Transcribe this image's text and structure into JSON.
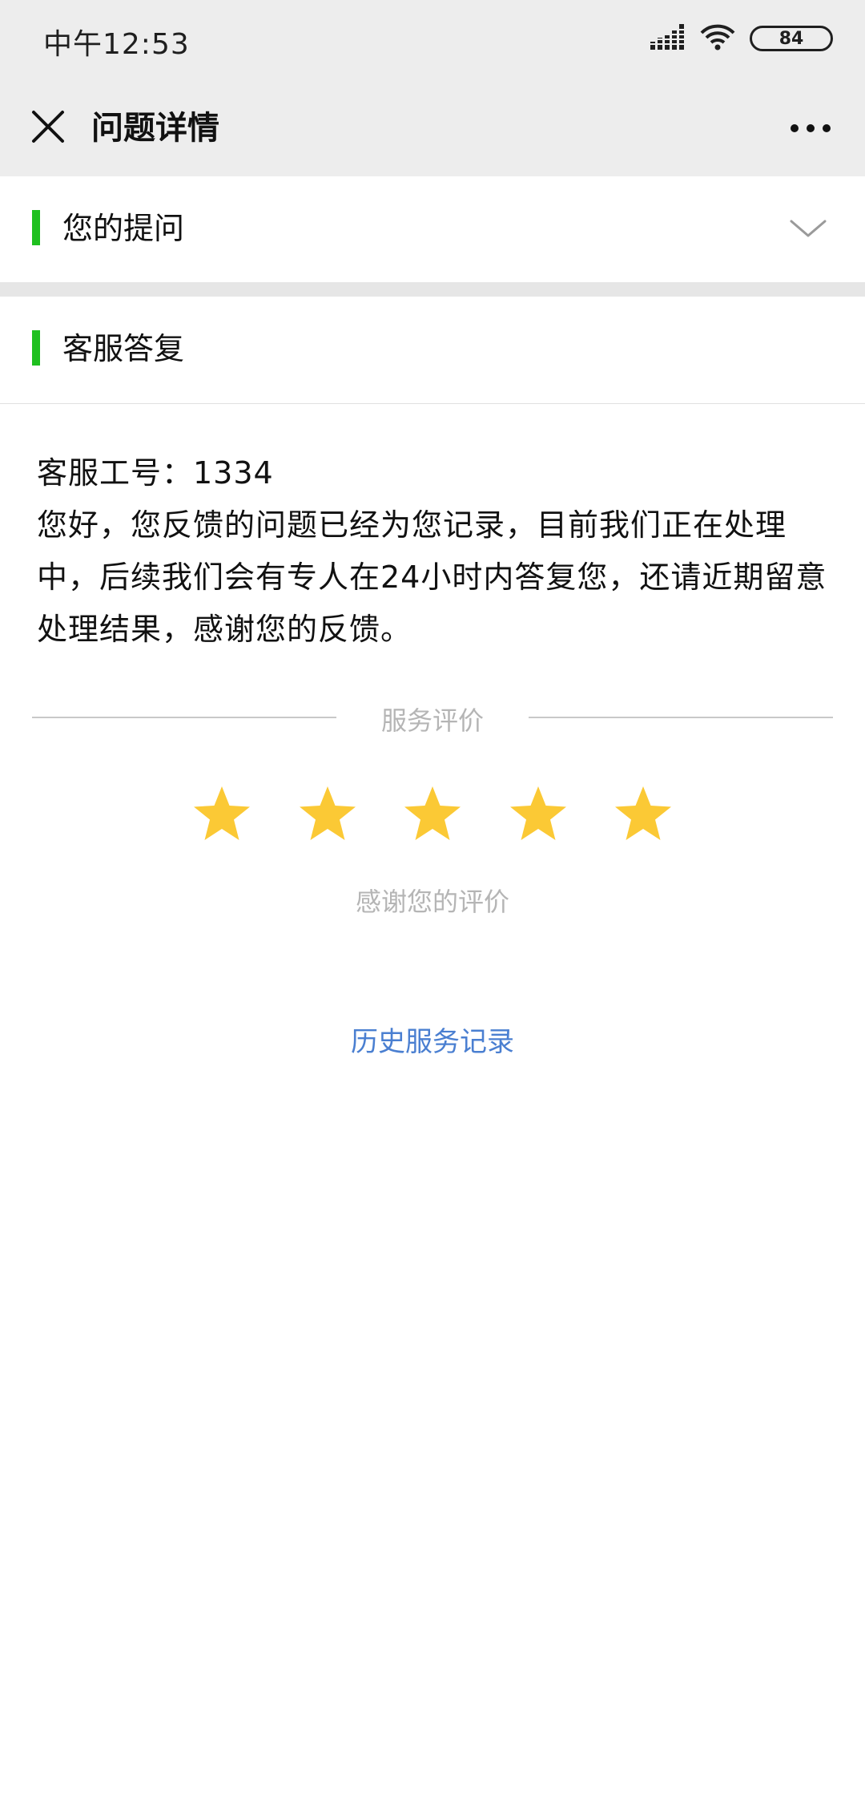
{
  "status_bar": {
    "time": "中午12:53",
    "battery": "84",
    "icons": [
      "signal-icon",
      "wifi-icon",
      "battery-icon"
    ]
  },
  "header": {
    "title": "问题详情",
    "close_icon": "close-icon",
    "more_icon": "more-icon"
  },
  "sections": {
    "question_title": "您的提问",
    "reply_title": "客服答复"
  },
  "reply": {
    "agent_id": "客服工号：1334",
    "message": "您好，您反馈的问题已经为您记录，目前我们正在处理中，后续我们会有专人在24小时内答复您，还请近期留意处理结果，感谢您的反馈。"
  },
  "rating": {
    "label": "服务评价",
    "stars": 5,
    "max_stars": 5,
    "thanks": "感谢您的评价"
  },
  "history_link": "历史服务记录",
  "colors": {
    "accent_green": "#1fc01f",
    "star": "#fbc935",
    "link": "#4a7fd1",
    "header_bg": "#ededed"
  }
}
